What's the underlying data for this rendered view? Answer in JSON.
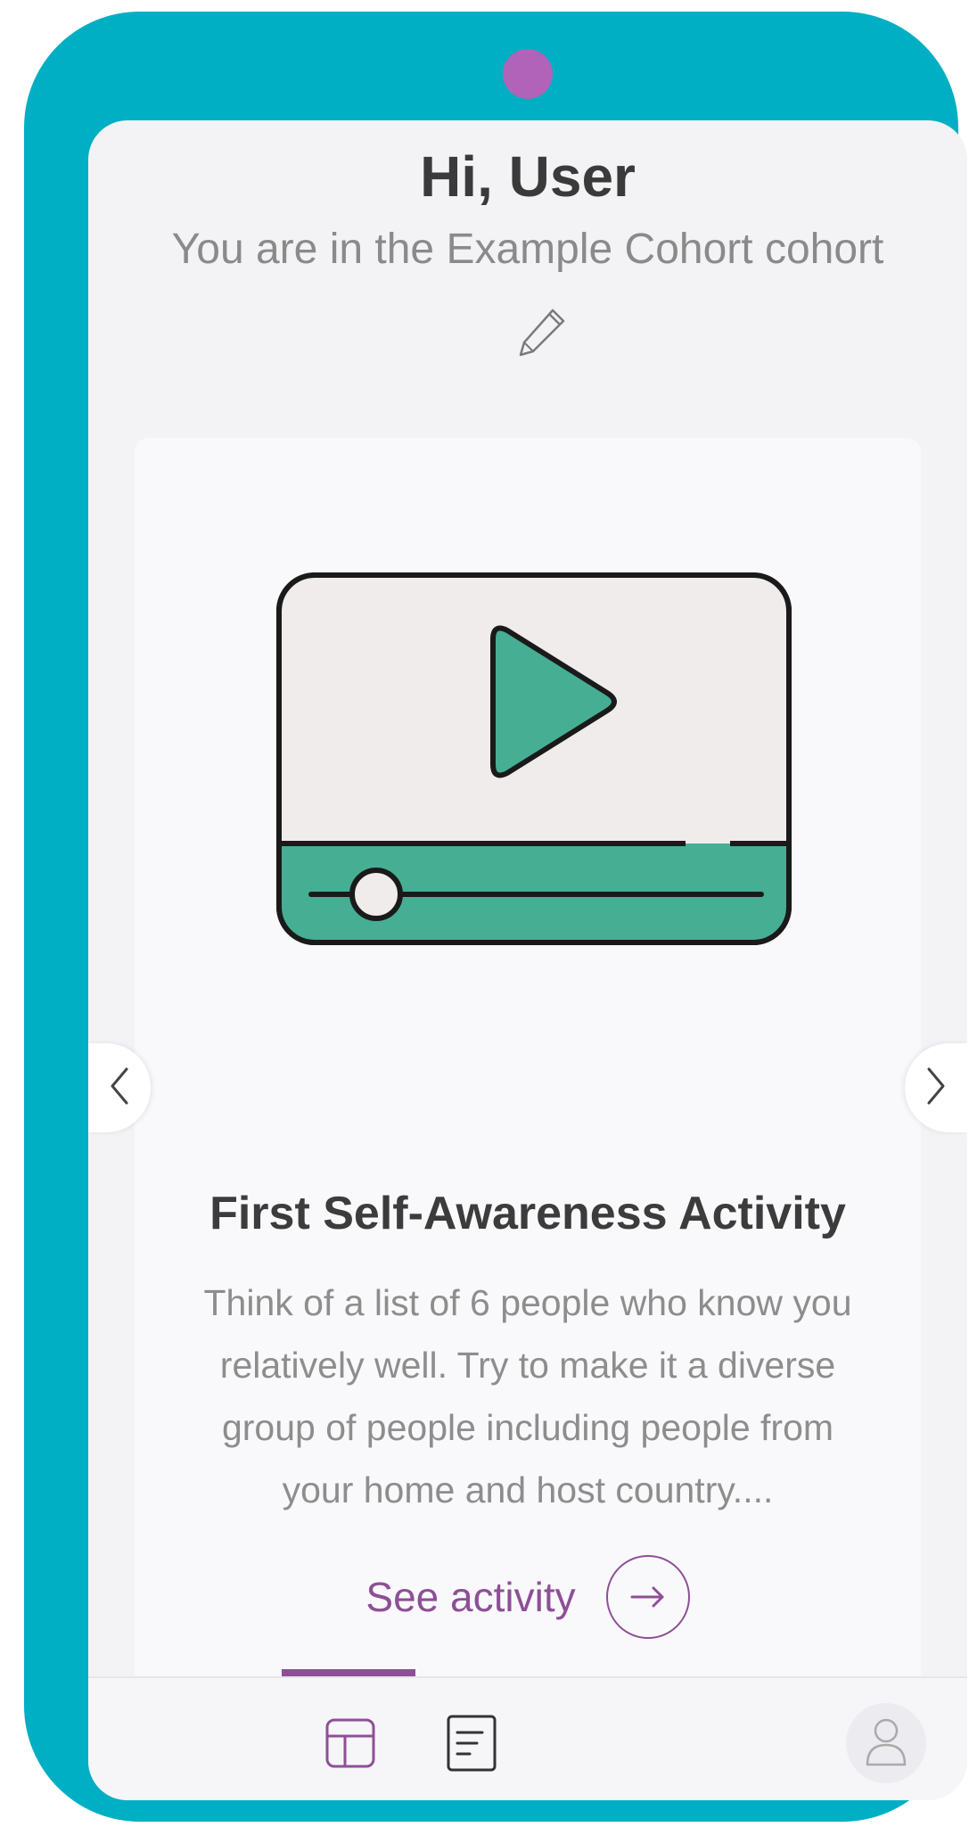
{
  "header": {
    "greeting": "Hi, User",
    "cohort_text": "You are in the Example Cohort cohort",
    "edit_icon": "pencil-icon"
  },
  "activity": {
    "illustration": "video-player-icon",
    "title": "First Self-Awareness Activity",
    "description": "Think of a list of 6 people who know you relatively well. Try to make it a diverse group of people including people from your home and host country....",
    "cta_label": "See activity",
    "cta_icon": "arrow-right-icon"
  },
  "carousel": {
    "prev_icon": "chevron-left-icon",
    "next_icon": "chevron-right-icon"
  },
  "bottom_nav": {
    "tabs": [
      "dashboard-icon",
      "list-icon",
      "profile-icon"
    ],
    "active_index": 0
  },
  "colors": {
    "frame": "#00afc3",
    "camera": "#b063b8",
    "accent": "#8e4f97",
    "video_green": "#46ae93",
    "video_screen": "#f0ecec"
  }
}
